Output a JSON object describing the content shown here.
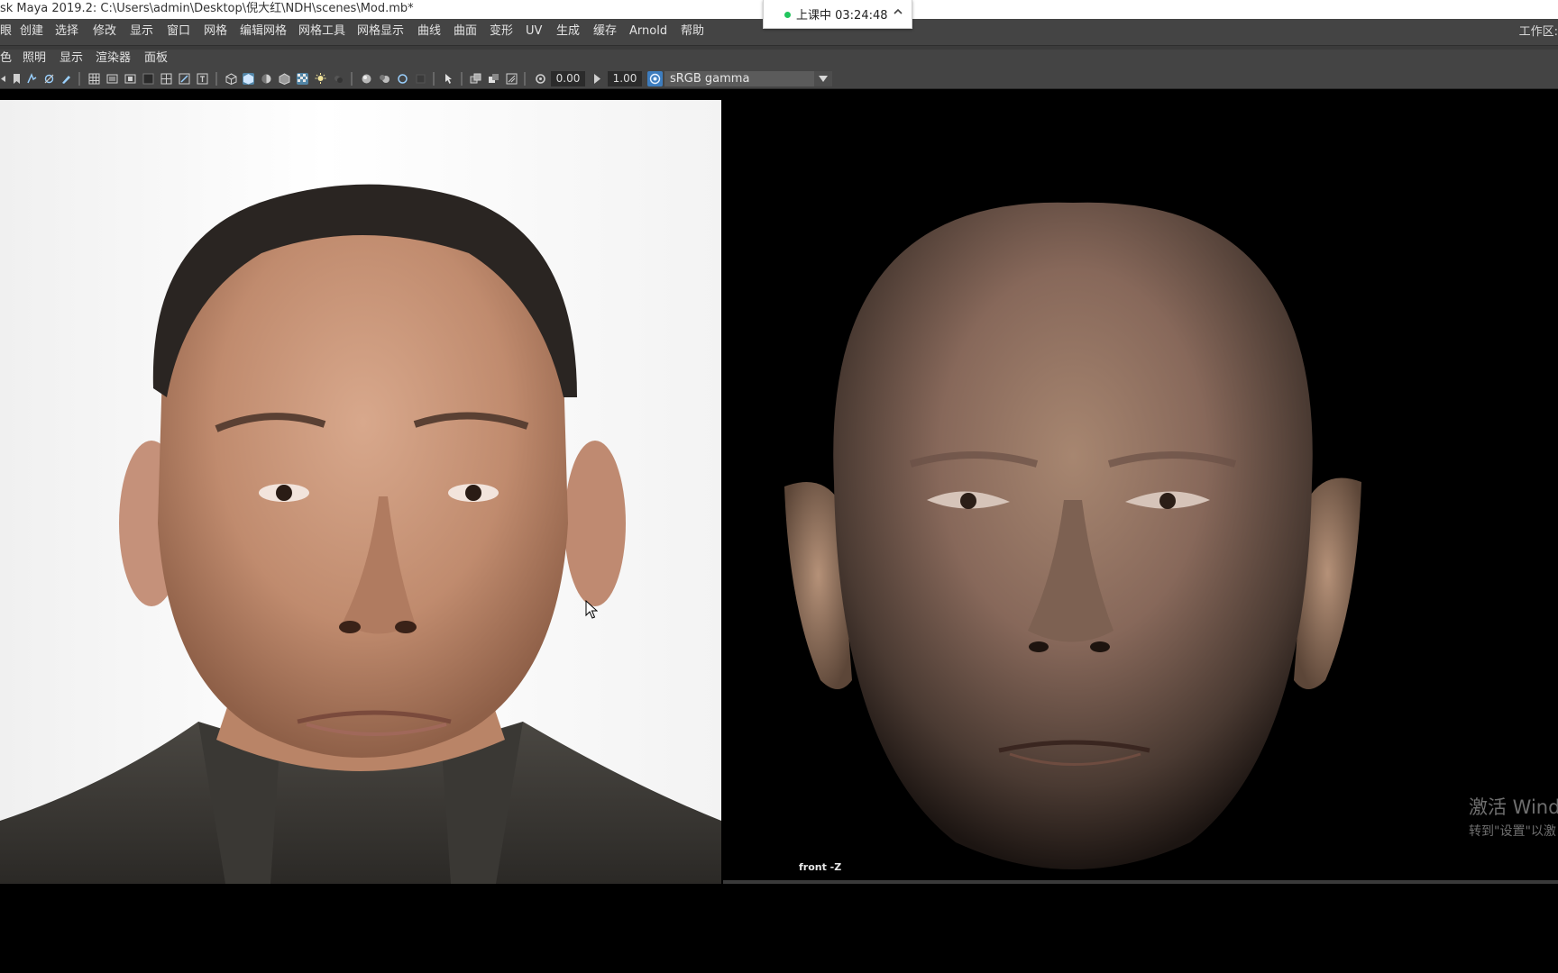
{
  "window": {
    "title": "sk Maya 2019.2: C:\\Users\\admin\\Desktop\\倪大红\\NDH\\scenes\\Mod.mb*"
  },
  "timer": {
    "text": "上课中 03:24:48"
  },
  "menubar": {
    "items": [
      "眼",
      "创建",
      "选择",
      "修改",
      "显示",
      "窗口",
      "网格",
      "编辑网格",
      "网格工具",
      "网格显示",
      "曲线",
      "曲面",
      "变形",
      "UV",
      "生成",
      "缓存",
      "Arnold",
      "帮助"
    ],
    "workspace": "工作区:"
  },
  "panel_menu": {
    "items": [
      "色",
      "照明",
      "显示",
      "渲染器",
      "面板"
    ]
  },
  "toolbar": {
    "exposure": "0.00",
    "gamma": "1.00",
    "color_space": "sRGB gamma",
    "icons": [
      "camera-attributes-icon",
      "bookmark-icon",
      "select-camera-icon",
      "lock-camera-icon",
      "image-plane-icon",
      "grid-icon",
      "film-gate-icon",
      "resolution-gate-icon",
      "gate-mask-icon",
      "field-chart-icon",
      "safe-action-icon",
      "safe-title-icon",
      "wireframe-icon",
      "smooth-shade-icon",
      "default-material-icon",
      "textured-icon",
      "xray-icon",
      "use-lights-icon",
      "shadows-icon",
      "ambient-occlusion-icon",
      "motion-blur-icon",
      "anti-aliasing-icon",
      "isolate-select-icon",
      "xray-joints-icon",
      "xray-active-icon",
      "backface-icon",
      "depth-icon",
      "exposure-reset-icon",
      "gamma-reset-icon",
      "color-management-icon"
    ]
  },
  "viewport": {
    "camera_label": "front -Z"
  },
  "watermark": {
    "line1": "激活 Wind",
    "line2": "转到\"设置\"以激"
  }
}
